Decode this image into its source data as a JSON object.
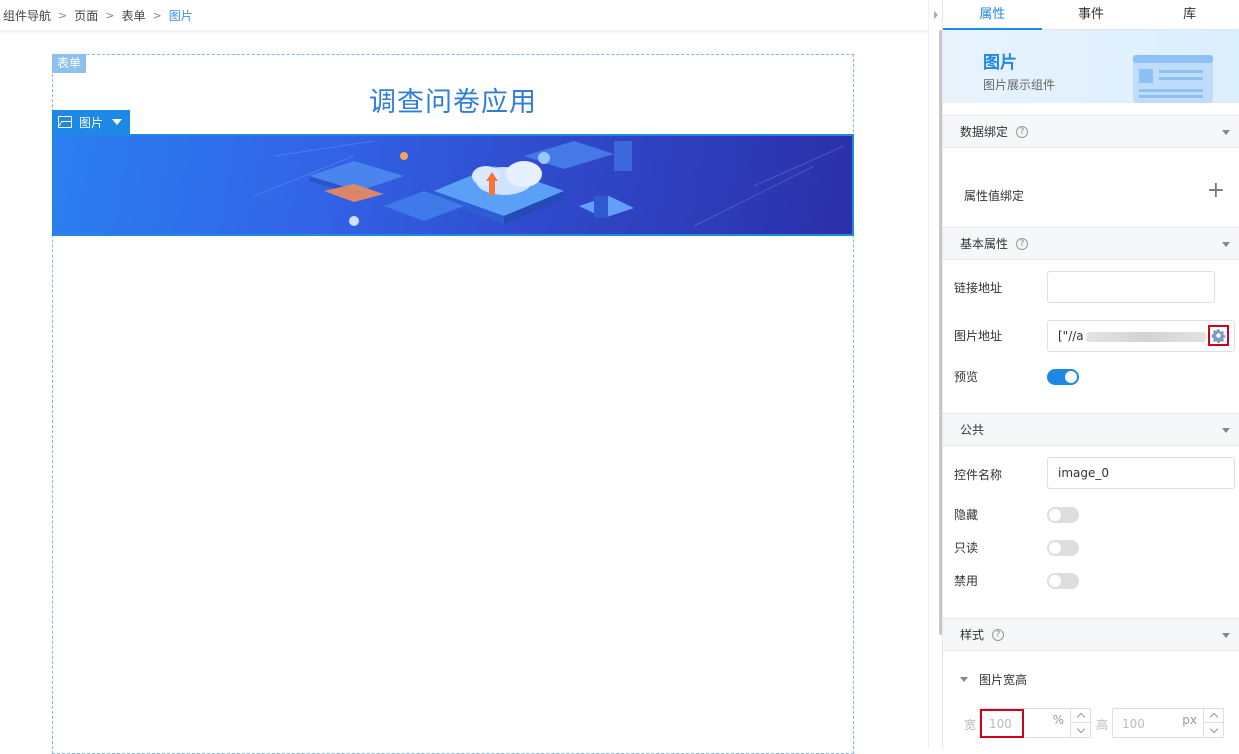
{
  "breadcrumb": {
    "items": [
      "组件导航",
      "页面",
      "表单",
      "图片"
    ]
  },
  "canvas": {
    "form_tag": "表单",
    "form_title": "调查问卷应用",
    "image_tag": "图片"
  },
  "panel": {
    "tabs": [
      "属性",
      "事件",
      "库"
    ],
    "active_tab": "属性",
    "component": {
      "name": "图片",
      "description": "图片展示组件"
    },
    "sections": {
      "data_binding": {
        "title": "数据绑定",
        "help": "?",
        "row_label": "属性值绑定",
        "add_icon": "+"
      },
      "basic": {
        "title": "基本属性",
        "help": "?",
        "link_label": "链接地址",
        "link_value": "",
        "src_label": "图片地址",
        "src_value": "[\"//a",
        "preview_label": "预览",
        "preview_on": true
      },
      "common": {
        "title": "公共",
        "name_label": "控件名称",
        "name_value": "image_0",
        "hidden_label": "隐藏",
        "hidden_on": false,
        "readonly_label": "只读",
        "readonly_on": false,
        "disabled_label": "禁用",
        "disabled_on": false
      },
      "style": {
        "title": "样式",
        "help": "?",
        "sub_title": "图片宽高",
        "width_label": "宽",
        "width_value": "100",
        "width_unit": "%",
        "height_label": "高",
        "height_value": "100",
        "height_unit": "px"
      }
    }
  },
  "colors": {
    "accent": "#1e88e5",
    "highlight": "#d0021b"
  }
}
